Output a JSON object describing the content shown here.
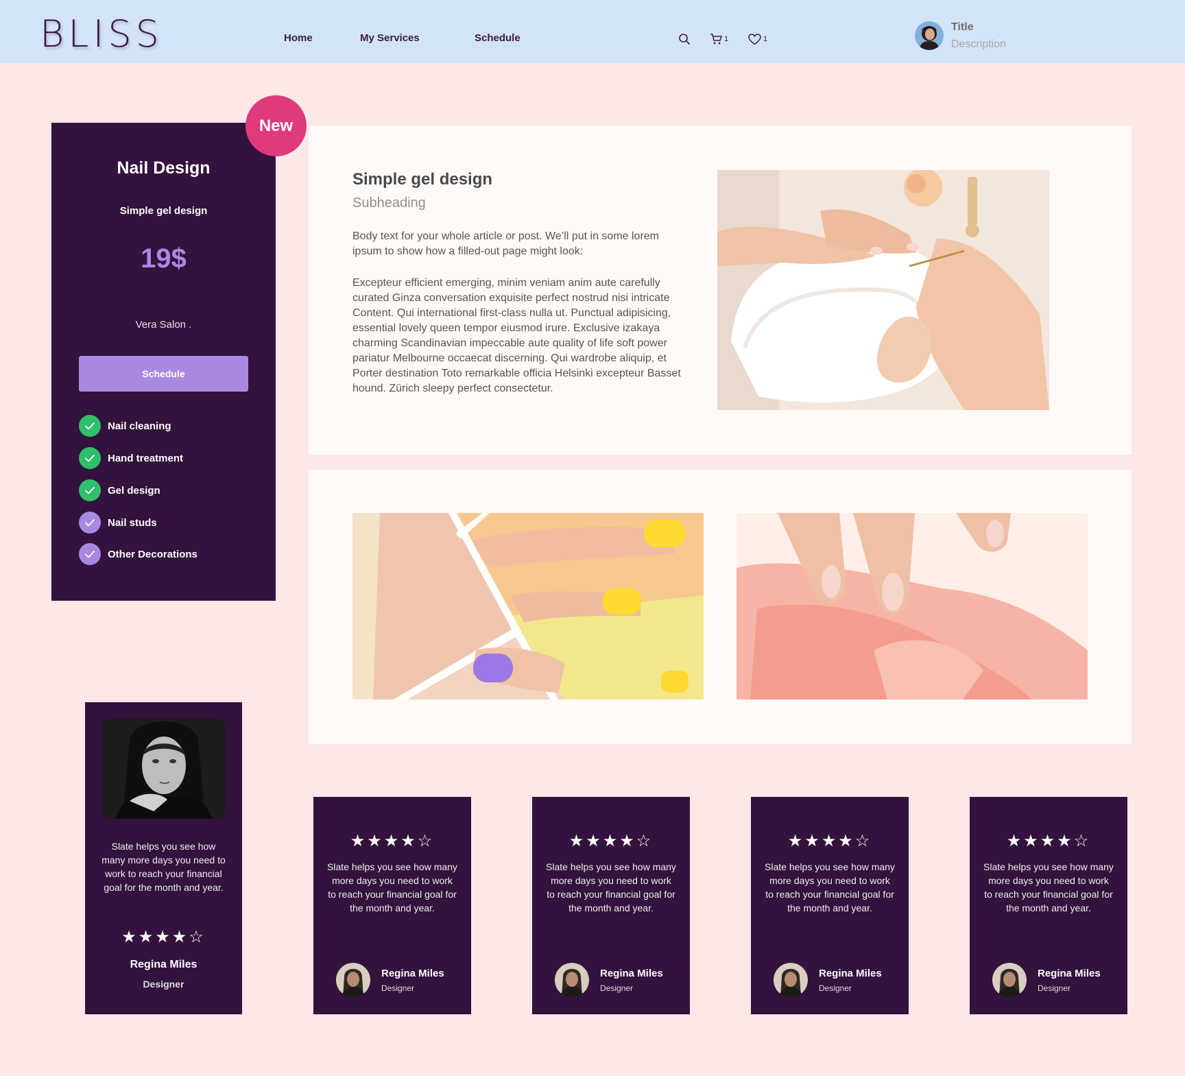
{
  "header": {
    "logo": "BLISS",
    "nav": [
      {
        "label": "Home"
      },
      {
        "label": "My Services"
      },
      {
        "label": "Schedule"
      }
    ],
    "cart_count": "1",
    "favorites_count": "1",
    "user": {
      "title": "Title",
      "description": "Description"
    },
    "icons": [
      "search-icon",
      "cart-icon",
      "heart-icon"
    ]
  },
  "service": {
    "badge": "New",
    "title": "Nail Design",
    "subtitle": "Simple gel design",
    "price": "19$",
    "salon": "Vera Salon .",
    "button_label": "Schedule",
    "features": [
      {
        "label": "Nail cleaning",
        "included": true
      },
      {
        "label": "Hand treatment",
        "included": true
      },
      {
        "label": "Gel design",
        "included": true
      },
      {
        "label": "Nail studs",
        "included": false
      },
      {
        "label": "Other Decorations",
        "included": false
      }
    ]
  },
  "article": {
    "title": "Simple gel design",
    "subheading": "Subheading",
    "intro": "Body text for your whole article or post. We’ll put in some lorem ipsum to show how a filled-out page might look:",
    "body": "Excepteur efficient emerging, minim veniam anim aute carefully curated Ginza conversation exquisite perfect nostrud nisi intricate Content. Qui  international first-class nulla ut. Punctual adipisicing, essential lovely queen tempor eiusmod irure. Exclusive izakaya charming Scandinavian impeccable aute quality of life soft power pariatur Melbourne occaecat discerning. Qui wardrobe aliquip, et Porter destination Toto remarkable officia Helsinki excepteur Basset hound. Zürich sleepy perfect consectetur."
  },
  "featured_testimonial": {
    "quote": "Slate helps you see how many more days you need to work to reach your financial goal for the month and year.",
    "rating": 4,
    "stars": "★★★★☆",
    "name": "Regina Miles",
    "role": "Designer"
  },
  "reviews": [
    {
      "stars": "★★★★☆",
      "rating": 4,
      "quote": "Slate helps you see how many more days you need to work to reach your financial goal for the month and year.",
      "name": "Regina Miles",
      "role": "Designer"
    },
    {
      "stars": "★★★★☆",
      "rating": 4,
      "quote": "Slate helps you see how many more days you need to work to reach your financial goal for the month and year.",
      "name": "Regina Miles",
      "role": "Designer"
    },
    {
      "stars": "★★★★☆",
      "rating": 4,
      "quote": "Slate helps you see how many more days you need to work to reach your financial goal for the month and year.",
      "name": "Regina Miles",
      "role": "Designer"
    },
    {
      "stars": "★★★★☆",
      "rating": 4,
      "quote": "Slate helps you see how many more days you need to work to reach your financial goal for the month and year.",
      "name": "Regina Miles",
      "role": "Designer"
    }
  ],
  "colors": {
    "header_bg": "#d3e3f8",
    "page_bg": "#fde8e8",
    "card_bg": "#33123d",
    "accent_purple": "#a889e2",
    "badge_pink": "#de3a7c",
    "check_green": "#2fbf6d"
  }
}
